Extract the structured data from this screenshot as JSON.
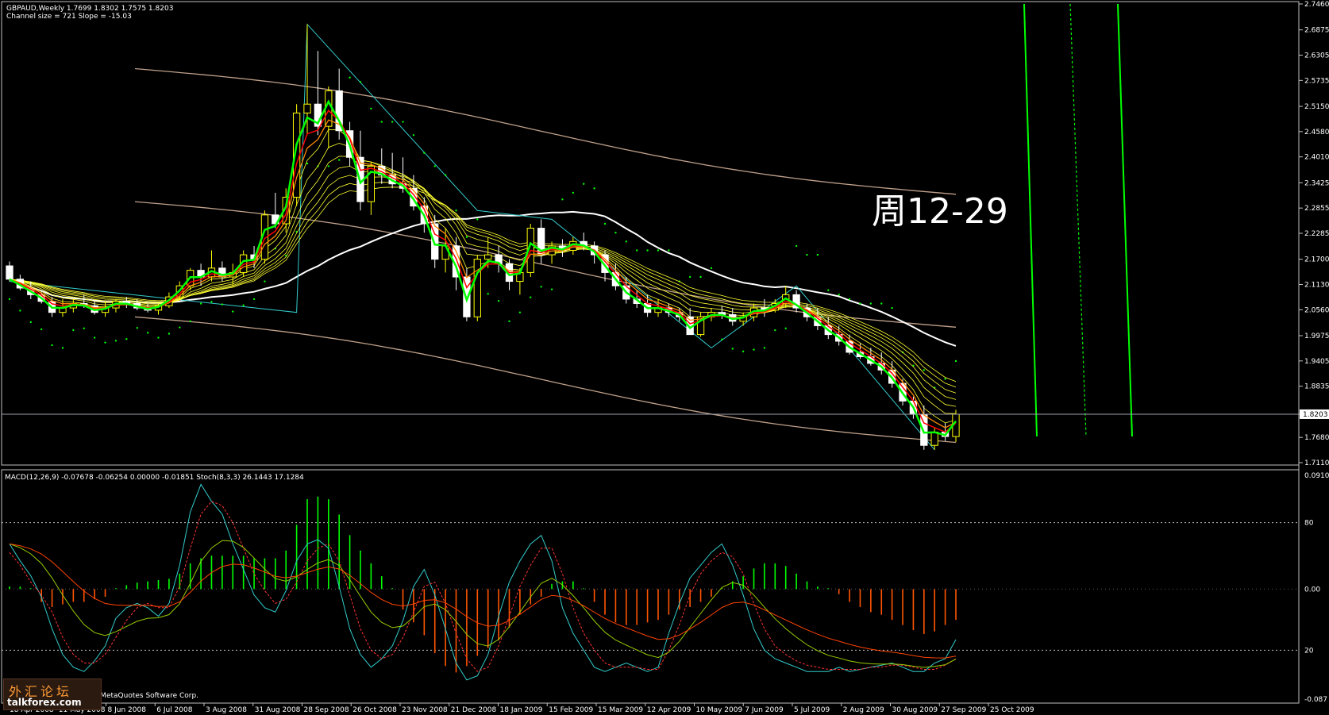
{
  "window": {
    "symbol_line": "GBPAUD,Weekly  1.7699 1.8302 1.7575 1.8203",
    "channel_line": "Channel size = 721 Slope = -15.03",
    "indicator_line": "MACD(12,26,9) -0.07678 -0.06254 0.00000 -0.01851  Stoch(8,3,3) 26.1443 17.1284",
    "copyright": "MetaTrader, © 2001-2008 MetaQuotes Software Corp.",
    "annotation": "周12-29",
    "current_price_label": "1.8203"
  },
  "watermark": {
    "cn": "外汇论坛",
    "en": "talkforex.com"
  },
  "colors": {
    "background": "#000000",
    "bull_candle": "#ffff00",
    "bear_candle": "#ffffff",
    "ma_fast": "#00ff00",
    "ma_red": "#ff0000",
    "ma_orange": "#ff8800",
    "ribbon": "#ffff33",
    "channel": "#bfa08a",
    "ma_long": "#ffffff",
    "zigzag": "#33cccc",
    "sar": "#00ff00",
    "macd_pos": "#00ff00",
    "macd_neg": "#ff5500",
    "stoch_main": "#33cccc",
    "stoch_signal": "#ff3333",
    "slow_line_a": "#99cc00",
    "slow_line_b": "#ff4400",
    "vline": "#00ff00"
  },
  "chart_data": [
    {
      "type": "candlestick",
      "title": "GBPAUD,Weekly",
      "x_tick_labels": [
        "18 Apr 2008",
        "11 May 2008",
        "8 Jun 2008",
        "6 Jul 2008",
        "3 Aug 2008",
        "31 Aug 2008",
        "28 Sep 2008",
        "26 Oct 2008",
        "23 Nov 2008",
        "21 Dec 2008",
        "18 Jan 2009",
        "15 Feb 2009",
        "15 Mar 2009",
        "12 Apr 2009",
        "10 May 2009",
        "7 Jun 2009",
        "5 Jul 2009",
        "2 Aug 2009",
        "30 Aug 2009",
        "27 Sep 2009",
        "25 Oct 2009"
      ],
      "y_tick_labels": [
        "2.7460",
        "2.6875",
        "2.6305",
        "2.5735",
        "2.5150",
        "2.4580",
        "2.4010",
        "2.3425",
        "2.2855",
        "2.2285",
        "2.1700",
        "2.1130",
        "2.0560",
        "1.9975",
        "1.9405",
        "1.8835",
        "1.8203",
        "1.7680",
        "1.7110"
      ],
      "ylim": [
        1.711,
        2.746
      ],
      "current_price": 1.8203,
      "ohlc": [
        [
          2.155,
          2.165,
          2.12,
          2.125
        ],
        [
          2.125,
          2.135,
          2.1,
          2.105
        ],
        [
          2.105,
          2.12,
          2.08,
          2.09
        ],
        [
          2.09,
          2.1,
          2.07,
          2.075
        ],
        [
          2.075,
          2.085,
          2.04,
          2.05
        ],
        [
          2.05,
          2.08,
          2.04,
          2.06
        ],
        [
          2.06,
          2.08,
          2.05,
          2.07
        ],
        [
          2.07,
          2.09,
          2.06,
          2.065
        ],
        [
          2.065,
          2.075,
          2.045,
          2.05
        ],
        [
          2.05,
          2.075,
          2.04,
          2.06
        ],
        [
          2.06,
          2.08,
          2.05,
          2.075
        ],
        [
          2.075,
          2.085,
          2.06,
          2.07
        ],
        [
          2.07,
          2.08,
          2.055,
          2.06
        ],
        [
          2.06,
          2.07,
          2.05,
          2.055
        ],
        [
          2.055,
          2.07,
          2.045,
          2.065
        ],
        [
          2.065,
          2.095,
          2.06,
          2.085
        ],
        [
          2.085,
          2.12,
          2.08,
          2.11
        ],
        [
          2.11,
          2.15,
          2.1,
          2.145
        ],
        [
          2.145,
          2.16,
          2.11,
          2.13
        ],
        [
          2.13,
          2.19,
          2.12,
          2.15
        ],
        [
          2.15,
          2.165,
          2.12,
          2.13
        ],
        [
          2.13,
          2.16,
          2.11,
          2.14
        ],
        [
          2.14,
          2.19,
          2.13,
          2.18
        ],
        [
          2.18,
          2.2,
          2.15,
          2.17
        ],
        [
          2.17,
          2.28,
          2.16,
          2.27
        ],
        [
          2.27,
          2.32,
          2.24,
          2.25
        ],
        [
          2.25,
          2.33,
          2.23,
          2.31
        ],
        [
          2.31,
          2.52,
          2.29,
          2.5
        ],
        [
          2.5,
          2.7,
          2.45,
          2.52
        ],
        [
          2.52,
          2.64,
          2.45,
          2.47
        ],
        [
          2.47,
          2.56,
          2.42,
          2.55
        ],
        [
          2.55,
          2.6,
          2.44,
          2.46
        ],
        [
          2.46,
          2.48,
          2.38,
          2.4
        ],
        [
          2.4,
          2.46,
          2.28,
          2.3
        ],
        [
          2.3,
          2.39,
          2.27,
          2.38
        ],
        [
          2.38,
          2.42,
          2.34,
          2.36
        ],
        [
          2.36,
          2.41,
          2.33,
          2.34
        ],
        [
          2.34,
          2.4,
          2.32,
          2.33
        ],
        [
          2.33,
          2.36,
          2.28,
          2.29
        ],
        [
          2.29,
          2.31,
          2.23,
          2.25
        ],
        [
          2.25,
          2.27,
          2.15,
          2.17
        ],
        [
          2.17,
          2.24,
          2.14,
          2.2
        ],
        [
          2.2,
          2.22,
          2.1,
          2.13
        ],
        [
          2.13,
          2.15,
          2.03,
          2.04
        ],
        [
          2.04,
          2.18,
          2.03,
          2.17
        ],
        [
          2.17,
          2.22,
          2.15,
          2.18
        ],
        [
          2.18,
          2.2,
          2.14,
          2.16
        ],
        [
          2.16,
          2.17,
          2.1,
          2.12
        ],
        [
          2.12,
          2.15,
          2.09,
          2.14
        ],
        [
          2.14,
          2.25,
          2.13,
          2.24
        ],
        [
          2.24,
          2.26,
          2.16,
          2.18
        ],
        [
          2.18,
          2.21,
          2.16,
          2.2
        ],
        [
          2.2,
          2.215,
          2.175,
          2.19
        ],
        [
          2.19,
          2.22,
          2.18,
          2.21
        ],
        [
          2.21,
          2.23,
          2.19,
          2.2
        ],
        [
          2.2,
          2.21,
          2.16,
          2.18
        ],
        [
          2.18,
          2.19,
          2.12,
          2.14
        ],
        [
          2.14,
          2.16,
          2.1,
          2.11
        ],
        [
          2.11,
          2.13,
          2.07,
          2.08
        ],
        [
          2.08,
          2.1,
          2.06,
          2.07
        ],
        [
          2.07,
          2.09,
          2.04,
          2.05
        ],
        [
          2.05,
          2.08,
          2.04,
          2.06
        ],
        [
          2.06,
          2.07,
          2.04,
          2.05
        ],
        [
          2.05,
          2.06,
          2.03,
          2.04
        ],
        [
          2.04,
          2.06,
          2.0,
          2.0
        ],
        [
          2.0,
          2.05,
          1.995,
          2.04
        ],
        [
          2.04,
          2.06,
          2.03,
          2.05
        ],
        [
          2.05,
          2.065,
          2.035,
          2.045
        ],
        [
          2.045,
          2.06,
          2.02,
          2.03
        ],
        [
          2.03,
          2.05,
          2.02,
          2.04
        ],
        [
          2.04,
          2.07,
          2.03,
          2.06
        ],
        [
          2.06,
          2.08,
          2.04,
          2.055
        ],
        [
          2.055,
          2.08,
          2.05,
          2.07
        ],
        [
          2.07,
          2.11,
          2.06,
          2.09
        ],
        [
          2.09,
          2.1,
          2.05,
          2.06
        ],
        [
          2.06,
          2.07,
          2.03,
          2.04
        ],
        [
          2.04,
          2.06,
          2.01,
          2.02
        ],
        [
          2.02,
          2.04,
          1.99,
          2.0
        ],
        [
          2.0,
          2.02,
          1.975,
          1.985
        ],
        [
          1.985,
          2.0,
          1.955,
          1.96
        ],
        [
          1.96,
          1.98,
          1.945,
          1.95
        ],
        [
          1.95,
          1.97,
          1.93,
          1.935
        ],
        [
          1.935,
          1.96,
          1.91,
          1.92
        ],
        [
          1.92,
          1.94,
          1.88,
          1.89
        ],
        [
          1.89,
          1.9,
          1.84,
          1.85
        ],
        [
          1.85,
          1.86,
          1.81,
          1.82
        ],
        [
          1.82,
          1.84,
          1.74,
          1.75
        ],
        [
          1.75,
          1.79,
          1.74,
          1.78
        ],
        [
          1.78,
          1.8,
          1.76,
          1.77
        ],
        [
          1.7699,
          1.8302,
          1.7575,
          1.8203
        ]
      ]
    },
    {
      "type": "bar",
      "title": "MACD(12,26,9)",
      "y_tick_labels": [
        "0.09106",
        "0.00",
        "-0.087"
      ],
      "ylim": [
        -0.087,
        0.09106
      ],
      "values": [
        0.002,
        0.002,
        0,
        -0.01,
        -0.014,
        -0.012,
        -0.01,
        -0.01,
        -0.008,
        -0.006,
        0,
        0.003,
        0.005,
        0.006,
        0.007,
        0.008,
        0.012,
        0.02,
        0.024,
        0.026,
        0.026,
        0.026,
        0.026,
        0.024,
        0.024,
        0.024,
        0.03,
        0.05,
        0.07,
        0.072,
        0.07,
        0.058,
        0.042,
        0.03,
        0.02,
        0.01,
        0,
        -0.016,
        -0.026,
        -0.036,
        -0.05,
        -0.06,
        -0.065,
        -0.06,
        -0.052,
        -0.046,
        -0.04,
        -0.03,
        -0.02,
        -0.012,
        -0.006,
        0.004,
        0.006,
        0.006,
        0,
        -0.01,
        -0.02,
        -0.026,
        -0.028,
        -0.028,
        -0.026,
        -0.024,
        -0.02,
        -0.016,
        -0.014,
        -0.01,
        -0.006,
        0,
        0.006,
        0.01,
        0.016,
        0.02,
        0.02,
        0.018,
        0.012,
        0.006,
        0.002,
        0,
        -0.004,
        -0.01,
        -0.014,
        -0.018,
        -0.02,
        -0.024,
        -0.028,
        -0.032,
        -0.035,
        -0.033,
        -0.028,
        -0.024
      ]
    },
    {
      "type": "line",
      "title": "Stoch(8,3,3)",
      "y_tick_labels": [
        "80",
        "20"
      ],
      "ylim": [
        0,
        100
      ],
      "series": [
        {
          "name": "Stoch main",
          "values": [
            70,
            62,
            55,
            45,
            30,
            18,
            12,
            10,
            15,
            22,
            35,
            40,
            42,
            40,
            36,
            42,
            60,
            85,
            98,
            90,
            84,
            70,
            58,
            46,
            40,
            38,
            48,
            62,
            70,
            72,
            68,
            50,
            30,
            18,
            12,
            16,
            22,
            34,
            50,
            58,
            46,
            30,
            14,
            6,
            8,
            18,
            36,
            52,
            62,
            70,
            74,
            62,
            40,
            28,
            20,
            12,
            10,
            12,
            14,
            12,
            10,
            12,
            28,
            42,
            54,
            60,
            66,
            70,
            60,
            46,
            30,
            20,
            16,
            14,
            12,
            10,
            10,
            10,
            12,
            10,
            11,
            12,
            13,
            14,
            12,
            10,
            10,
            14,
            16,
            25
          ]
        },
        {
          "name": "Stoch signal",
          "values": [
            66,
            60,
            52,
            46,
            38,
            26,
            18,
            14,
            14,
            18,
            26,
            34,
            40,
            42,
            40,
            40,
            50,
            68,
            84,
            90,
            88,
            80,
            68,
            56,
            48,
            42,
            44,
            52,
            62,
            68,
            70,
            62,
            46,
            30,
            20,
            16,
            18,
            26,
            38,
            50,
            52,
            42,
            28,
            16,
            10,
            12,
            22,
            36,
            50,
            60,
            68,
            68,
            56,
            40,
            28,
            20,
            14,
            12,
            12,
            12,
            11,
            11,
            20,
            32,
            46,
            56,
            62,
            66,
            64,
            56,
            42,
            30,
            22,
            18,
            15,
            13,
            12,
            11,
            11,
            11,
            11,
            12,
            12,
            13,
            13,
            12,
            11,
            11,
            13,
            16
          ]
        }
      ]
    }
  ]
}
